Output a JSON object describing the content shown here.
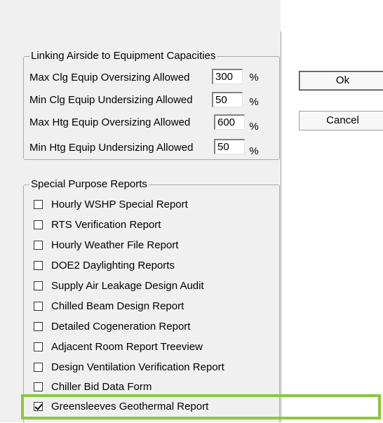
{
  "linking_group": {
    "title": "Linking Airside to Equipment Capacities",
    "rows": [
      {
        "label": "Max Clg Equip Oversizing Allowed",
        "value": "300",
        "unit": "%"
      },
      {
        "label": "Min Clg Equip Undersizing Allowed",
        "value": "50",
        "unit": "%"
      },
      {
        "label": "Max Htg Equip Oversizing Allowed",
        "value": "600",
        "unit": "%"
      },
      {
        "label": "Min Htg Equip Undersizing Allowed",
        "value": "50",
        "unit": "%"
      }
    ]
  },
  "reports_group": {
    "title": "Special Purpose Reports",
    "items": [
      {
        "label": "Hourly WSHP Special Report",
        "checked": false
      },
      {
        "label": "RTS Verification Report",
        "checked": false
      },
      {
        "label": "Hourly Weather File Report",
        "checked": false
      },
      {
        "label": "DOE2 Daylighting Reports",
        "checked": false
      },
      {
        "label": "Supply Air Leakage Design Audit",
        "checked": false
      },
      {
        "label": "Chilled Beam Design Report",
        "checked": false
      },
      {
        "label": "Detailed Cogeneration Report",
        "checked": false
      },
      {
        "label": "Adjacent Room Report Treeview",
        "checked": false
      },
      {
        "label": "Design Ventilation Verification Report",
        "checked": false
      },
      {
        "label": "Chiller Bid Data Form",
        "checked": false
      },
      {
        "label": "Greensleeves Geothermal Report",
        "checked": true
      }
    ]
  },
  "buttons": {
    "ok": "Ok",
    "cancel": "Cancel"
  },
  "colors": {
    "highlight": "#8cc63f",
    "dialog_bg": "#f0f0f0"
  }
}
